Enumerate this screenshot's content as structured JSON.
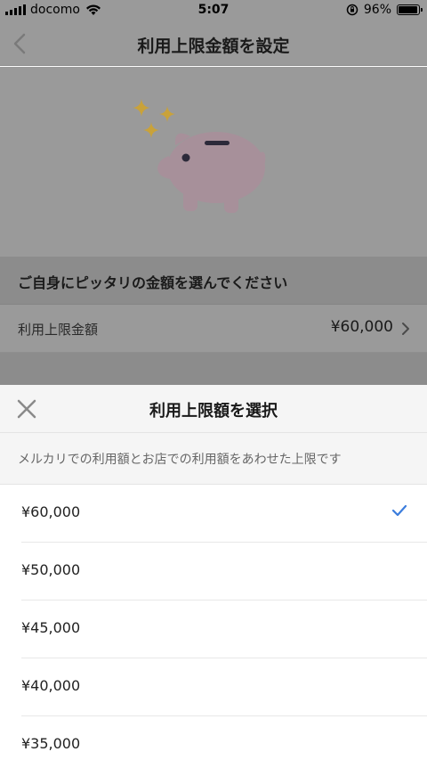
{
  "status_bar": {
    "carrier": "docomo",
    "time": "5:07",
    "battery": "96%",
    "battery_level": 0.96
  },
  "nav": {
    "title": "利用上限金額を設定",
    "back_icon": "chevron-left-icon"
  },
  "hero": {
    "icon": "piggy-bank-icon",
    "sparkle_color": "#d4a52a",
    "pig_color": "#b0919b"
  },
  "section": {
    "header": "ご自身にピッタリの金額を選んでください"
  },
  "limit": {
    "label": "利用上限金額",
    "value": "¥60,000"
  },
  "sheet": {
    "title": "利用上限額を選択",
    "description": "メルカリでの利用額とお店での利用額をあわせた上限です",
    "options": [
      {
        "amount": "¥60,000",
        "selected": true
      },
      {
        "amount": "¥50,000",
        "selected": false
      },
      {
        "amount": "¥45,000",
        "selected": false
      },
      {
        "amount": "¥40,000",
        "selected": false
      },
      {
        "amount": "¥35,000",
        "selected": false
      }
    ],
    "check_color": "#3b7ddd"
  }
}
